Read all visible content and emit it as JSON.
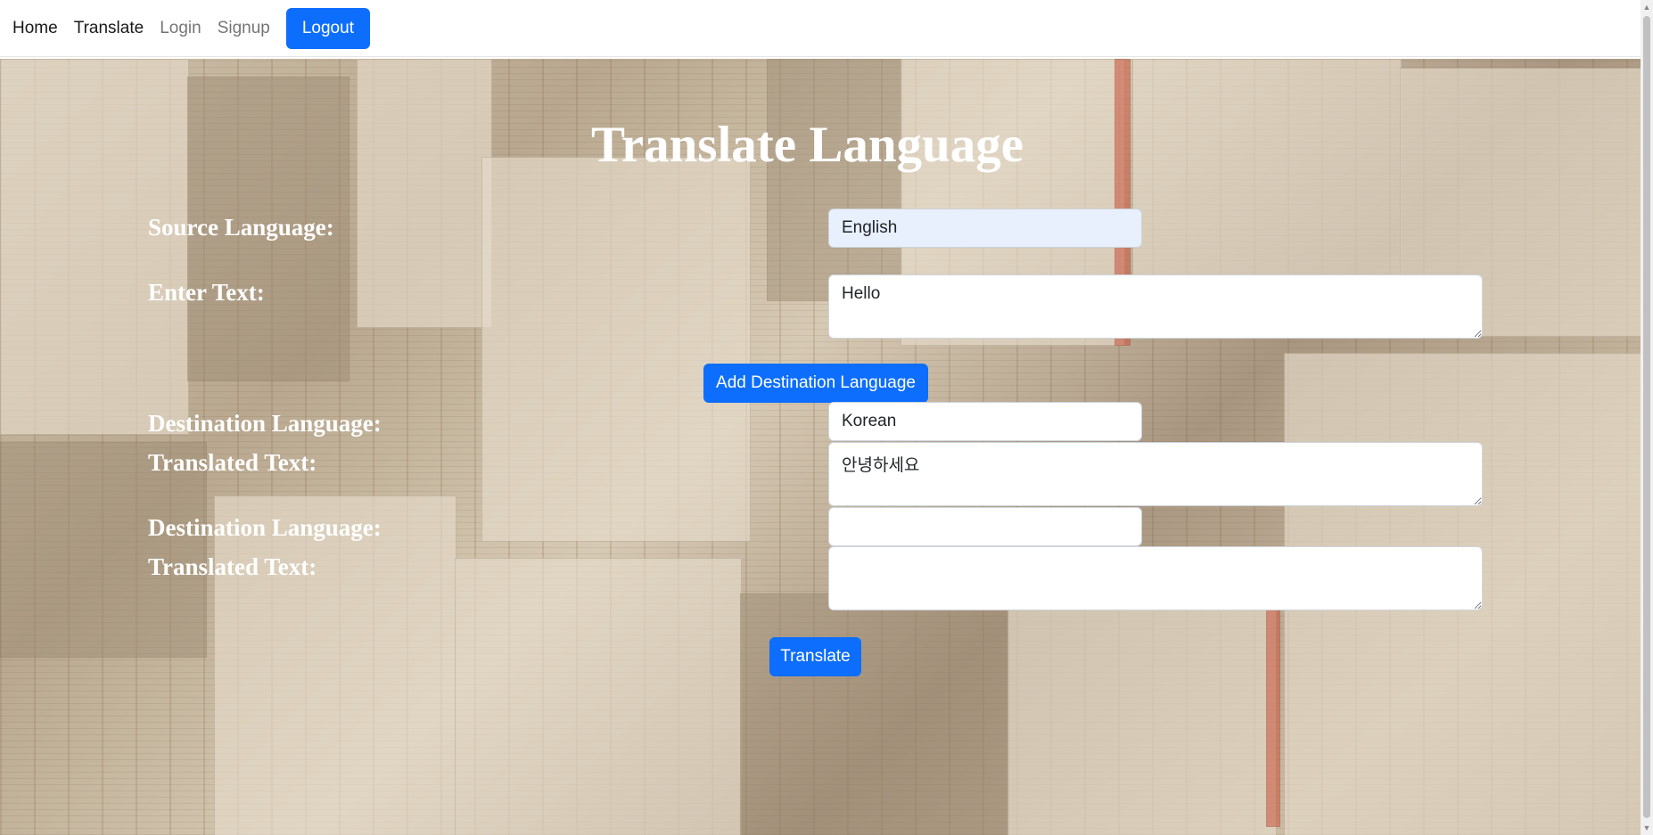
{
  "navbar": {
    "links": [
      "Home",
      "Translate",
      "Login",
      "Signup"
    ],
    "logout_label": "Logout"
  },
  "colors": {
    "accent": "#0d6efd",
    "label_text": "#ffffff"
  },
  "form": {
    "title": "Translate Language",
    "source_language_label": "Source Language:",
    "source_language_value": "English",
    "enter_text_label": "Enter Text:",
    "enter_text_value": "Hello",
    "add_destination_label": "Add Destination Language",
    "destinations": [
      {
        "language_label": "Destination Language:",
        "language_value": "Korean",
        "translated_label": "Translated Text:",
        "translated_value": "안녕하세요"
      },
      {
        "language_label": "Destination Language:",
        "language_value": "",
        "translated_label": "Translated Text:",
        "translated_value": ""
      }
    ],
    "translate_button_label": "Translate"
  }
}
